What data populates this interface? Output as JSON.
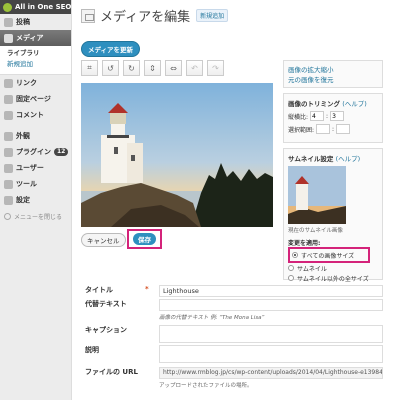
{
  "sidebar": {
    "brand": "All in One SEO",
    "items": [
      {
        "label": "投稿",
        "icon": "pin-icon"
      },
      {
        "label": "メディア",
        "icon": "media-icon",
        "active": true
      },
      {
        "label": "リンク",
        "icon": "link-icon"
      },
      {
        "label": "固定ページ",
        "icon": "page-icon"
      },
      {
        "label": "コメント",
        "icon": "comment-icon"
      },
      {
        "label": "外観",
        "icon": "appearance-icon"
      },
      {
        "label": "プラグイン",
        "icon": "plugin-icon",
        "badge": "12"
      },
      {
        "label": "ユーザー",
        "icon": "user-icon"
      },
      {
        "label": "ツール",
        "icon": "tool-icon"
      },
      {
        "label": "設定",
        "icon": "settings-icon"
      }
    ],
    "media_sub": [
      "ライブラリ",
      "新規追加"
    ],
    "collapse": "メニューを閉じる"
  },
  "header": {
    "title": "メディアを編集",
    "add_new": "新規追加",
    "update": "メディアを更新"
  },
  "toolbar": [
    "crop-icon",
    "rotate-left-icon",
    "rotate-right-icon",
    "flip-vertical-icon",
    "flip-horizontal-icon",
    "undo-icon",
    "redo-icon"
  ],
  "buttons": {
    "cancel": "キャンセル",
    "save": "保存"
  },
  "panels": {
    "scale": {
      "link1": "画像の拡大縮小",
      "link2": "元の画像を復元"
    },
    "crop": {
      "title": "画像のトリミング",
      "help": "(ヘルプ)",
      "ratio_label": "縦横比:",
      "ratio_w": "4",
      "ratio_sep": ":",
      "ratio_h": "3",
      "sel_label": "選択範囲:",
      "sel_sep": ":"
    },
    "thumb": {
      "title": "サムネイル設定",
      "help": "(ヘルプ)",
      "current": "現在のサムネイル画像",
      "apply": "変更を適用:",
      "options": [
        "すべての画像サイズ",
        "サムネイル",
        "サムネイル以外の全サイズ"
      ]
    }
  },
  "form": {
    "title_label": "タイトル",
    "title_value": "Lighthouse",
    "alt_label": "代替テキスト",
    "alt_hint": "画像の代替テキスト 例: “The Mona Lisa”",
    "caption_label": "キャプション",
    "desc_label": "説明",
    "url_label": "ファイルの URL",
    "url_value": "http://www.rmblog.jp/cs/wp-content/uploads/2014/04/Lighthouse-e13984",
    "url_hint": "アップロードされたファイルの場所。"
  }
}
